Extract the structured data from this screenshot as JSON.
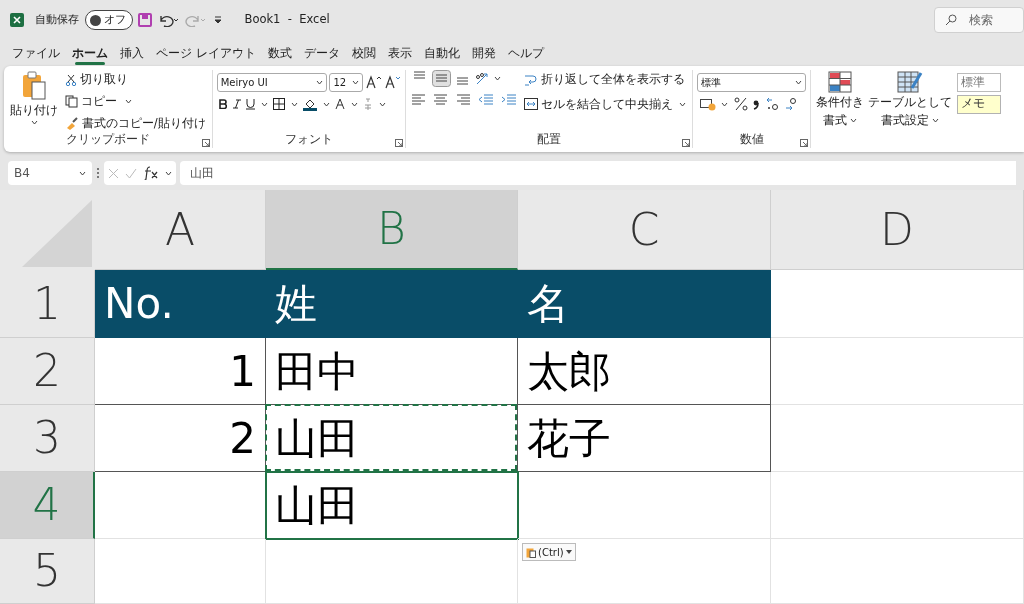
{
  "title_bar": {
    "autosave_label": "自動保存",
    "autosave": {
      "label": "オフ",
      "on": false
    },
    "title": "Book1  -  Excel",
    "search_placeholder": "検索"
  },
  "tabs": [
    {
      "label": "ファイル",
      "selected": false
    },
    {
      "label": "ホーム",
      "selected": true
    },
    {
      "label": "挿入",
      "selected": false
    },
    {
      "label": "ページ レイアウト",
      "selected": false
    },
    {
      "label": "数式",
      "selected": false
    },
    {
      "label": "データ",
      "selected": false
    },
    {
      "label": "校閲",
      "selected": false
    },
    {
      "label": "表示",
      "selected": false
    },
    {
      "label": "自動化",
      "selected": false
    },
    {
      "label": "開発",
      "selected": false
    },
    {
      "label": "ヘルプ",
      "selected": false
    }
  ],
  "ribbon": {
    "clipboard": {
      "paste": "貼り付け",
      "cut": "切り取り",
      "copy": "コピー",
      "format_painter": "書式のコピー/貼り付け",
      "label": "クリップボード"
    },
    "font": {
      "font_name": "Meiryo UI",
      "font_size": "12",
      "label": "フォント"
    },
    "alignment": {
      "wrap_text": "折り返して全体を表示する",
      "merge_center": "セルを結合して中央揃え",
      "label": "配置",
      "vertical_align": [
        {
          "selected": false
        },
        {
          "selected": true
        },
        {
          "selected": false
        }
      ]
    },
    "number": {
      "format": "標準",
      "label": "数値"
    },
    "styles": {
      "conditional_formatting": "条件付き",
      "conditional_formatting_2": "書式",
      "format_as_table": "テーブルとして",
      "format_as_table_2": "書式設定",
      "cell_styles": [
        {
          "label": "標準",
          "kind": "normal"
        },
        {
          "label": "メモ",
          "kind": "note"
        }
      ]
    }
  },
  "formula_bar": {
    "name_box": "B4",
    "content": "山田"
  },
  "sheet": {
    "columns": [
      {
        "label": "A",
        "selected": false
      },
      {
        "label": "B",
        "selected": true
      },
      {
        "label": "C",
        "selected": false
      },
      {
        "label": "D",
        "selected": false
      }
    ],
    "rows": [
      {
        "label": "1",
        "selected": false,
        "cells": [
          {
            "text": "No.",
            "kind": "header"
          },
          {
            "text": "姓",
            "kind": "header"
          },
          {
            "text": "名",
            "kind": "header"
          },
          {
            "kind": "plain"
          }
        ]
      },
      {
        "label": "2",
        "selected": false,
        "cells": [
          {
            "text": "1",
            "kind": "number"
          },
          {
            "text": "田中",
            "kind": "text"
          },
          {
            "text": "太郎",
            "kind": "text"
          },
          {
            "kind": "plain"
          }
        ]
      },
      {
        "label": "3",
        "selected": false,
        "cells": [
          {
            "text": "2",
            "kind": "number"
          },
          {
            "text": "山田",
            "kind": "text",
            "copy_marquee": true
          },
          {
            "text": "花子",
            "kind": "text"
          },
          {
            "kind": "plain"
          }
        ]
      },
      {
        "label": "4",
        "selected": true,
        "cells": [
          {
            "kind": "plain"
          },
          {
            "text": "山田",
            "kind": "plain",
            "active": true
          },
          {
            "kind": "plain"
          },
          {
            "kind": "plain"
          }
        ]
      },
      {
        "label": "5",
        "selected": false,
        "cells": [
          {
            "kind": "plain"
          },
          {
            "kind": "plain"
          },
          {
            "kind": "plain"
          },
          {
            "kind": "plain"
          }
        ]
      }
    ],
    "paste_options": "(Ctrl)"
  }
}
